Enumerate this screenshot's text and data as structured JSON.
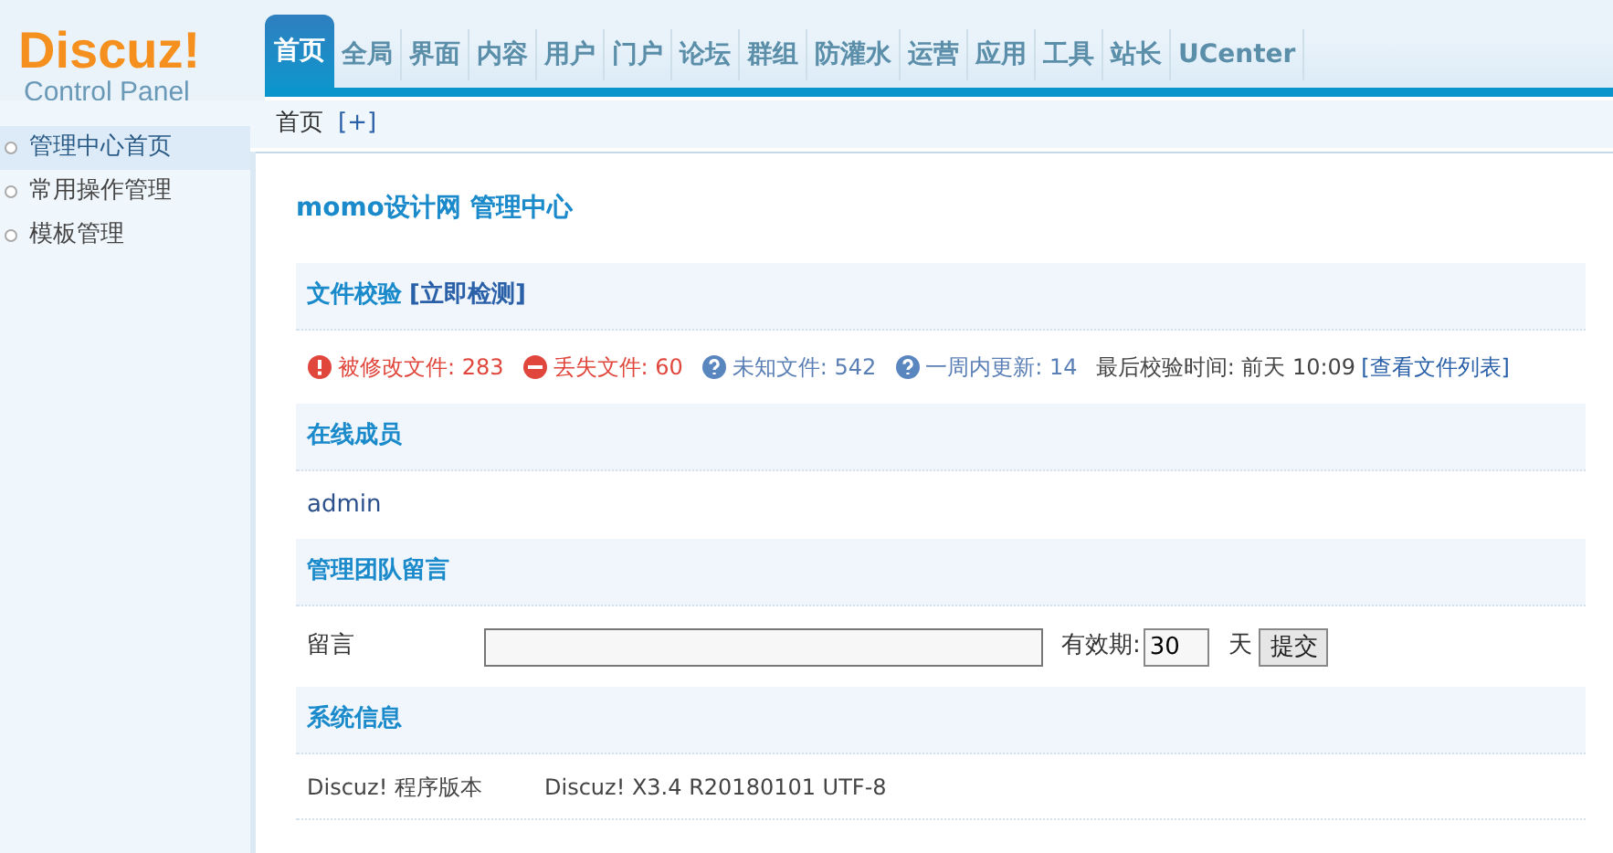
{
  "logo": {
    "brand": "Discuz!",
    "subtitle": "Control Panel"
  },
  "nav_tabs": [
    {
      "label": "首页",
      "selected": true
    },
    {
      "label": "全局",
      "selected": false
    },
    {
      "label": "界面",
      "selected": false
    },
    {
      "label": "内容",
      "selected": false
    },
    {
      "label": "用户",
      "selected": false
    },
    {
      "label": "门户",
      "selected": false
    },
    {
      "label": "论坛",
      "selected": false
    },
    {
      "label": "群组",
      "selected": false
    },
    {
      "label": "防灌水",
      "selected": false
    },
    {
      "label": "运营",
      "selected": false
    },
    {
      "label": "应用",
      "selected": false
    },
    {
      "label": "工具",
      "selected": false
    },
    {
      "label": "站长",
      "selected": false
    },
    {
      "label": "UCenter",
      "selected": false
    }
  ],
  "breadcrumb": {
    "current": "首页",
    "add": "[+]"
  },
  "sidebar": {
    "items": [
      {
        "label": "管理中心首页",
        "selected": true
      },
      {
        "label": "常用操作管理",
        "selected": false
      },
      {
        "label": "模板管理",
        "selected": false
      }
    ]
  },
  "page_title": "momo设计网 管理中心",
  "file_check": {
    "title": "文件校验",
    "action": "[立即检测]",
    "stats": [
      {
        "kind": "modified",
        "text": "被修改文件: 283"
      },
      {
        "kind": "missing",
        "text": "丢失文件: 60"
      },
      {
        "kind": "unknown",
        "text": "未知文件: 542"
      },
      {
        "kind": "updated",
        "text": "一周内更新: 14"
      }
    ],
    "last_check": "最后校验时间: 前天 10:09",
    "list_link": "[查看文件列表]"
  },
  "online_members": {
    "title": "在线成员",
    "members": [
      "admin"
    ]
  },
  "team_message": {
    "title": "管理团队留言",
    "label": "留言",
    "validity_label": "有效期:",
    "validity_value": "30",
    "unit": "天",
    "submit": "提交"
  },
  "system_info": {
    "title": "系统信息",
    "rows": [
      {
        "label": "Discuz! 程序版本",
        "value": "Discuz! X3.4 R20180101 UTF-8"
      }
    ]
  }
}
